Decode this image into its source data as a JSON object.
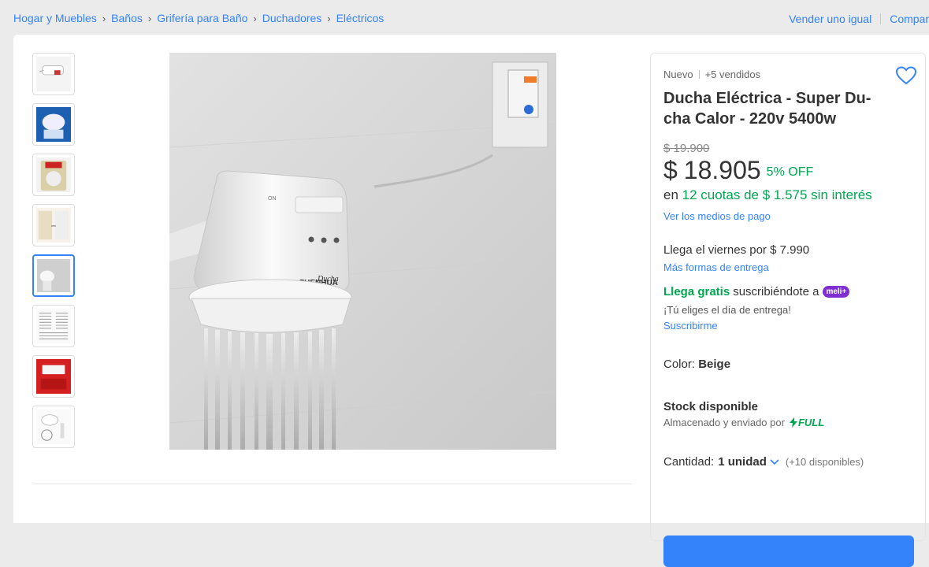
{
  "breadcrumb": [
    "Hogar y Muebles",
    "Baños",
    "Grifería para Baño",
    "Duchadores",
    "Eléctricos"
  ],
  "top_actions": {
    "sell": "Vender uno igual",
    "share": "Compar"
  },
  "gallery": {
    "thumbnail_count": 8,
    "active_index": 4
  },
  "product": {
    "condition": "Nuevo",
    "sold": "+5 vendidos",
    "title": "Ducha Eléctrica - Super Du-cha Calor - 220v 5400w",
    "old_price": "$ 19.900",
    "currency": "$",
    "price": "18.905",
    "discount": "5% OFF",
    "installments_prefix": "en",
    "installments": "12 cuotas de $ 1.575 sin interés",
    "payment_link": "Ver los medios de pago",
    "arrives": "Llega el viernes por $ 7.990",
    "more_delivery": "Más formas de entrega",
    "free_label": "Llega gratis",
    "free_rest": "suscribiéndote a",
    "meli_badge": "meli+",
    "choose_day": "¡Tú eliges el día de entrega!",
    "subscribe": "Suscribirme",
    "color_label": "Color:",
    "color_value": "Beige",
    "stock": "Stock disponible",
    "stored": "Almacenado y enviado por",
    "full": "FULL",
    "qty_label": "Cantidad:",
    "qty_value": "1 unidad",
    "qty_available": "(+10 disponibles)"
  },
  "colors": {
    "accent": "#3483fa",
    "green": "#00a650",
    "meli": "#7e2ed1"
  },
  "image_text": {
    "brand": "ZHENHUA",
    "model": "Ducha",
    "on": "ON"
  }
}
